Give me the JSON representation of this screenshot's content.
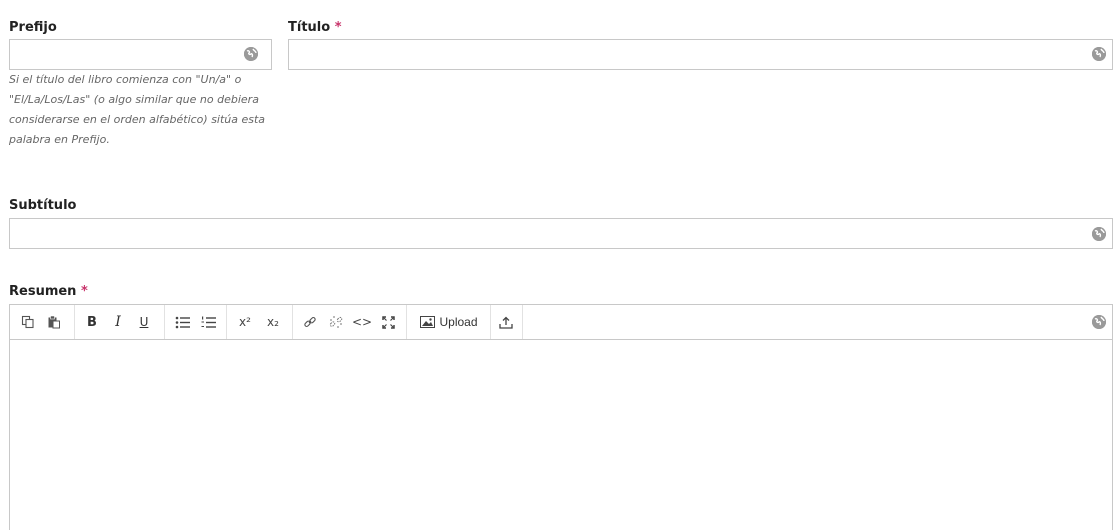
{
  "prefix": {
    "label": "Prefijo",
    "value": "",
    "help": "Si el título del libro comienza con \"Un/a\" o \"El/La/Los/Las\" (o algo similar que no debiera considerarse en el orden alfabético) sitúa esta palabra en Prefijo."
  },
  "title": {
    "label": "Título",
    "required_mark": "*",
    "value": ""
  },
  "subtitle": {
    "label": "Subtítulo",
    "value": ""
  },
  "abstract": {
    "label": "Resumen",
    "required_mark": "*",
    "value": "",
    "toolbar": {
      "copy_icon": "copy-icon",
      "paste_icon": "paste-icon",
      "bold": "B",
      "italic": "I",
      "underline": "U",
      "bullet_list_icon": "bullet-list-icon",
      "numbered_list_icon": "numbered-list-icon",
      "superscript": "x²",
      "subscript": "x₂",
      "link_icon": "link-icon",
      "unlink_icon": "unlink-icon",
      "code": "<>",
      "fullscreen_icon": "fullscreen-icon",
      "upload_label": "Upload",
      "upload_file_icon": "upload-file-icon"
    }
  },
  "colors": {
    "required": "#c8336a",
    "border": "#c8c8c8",
    "help_text": "#666666",
    "globe": "#9a9a9a"
  }
}
